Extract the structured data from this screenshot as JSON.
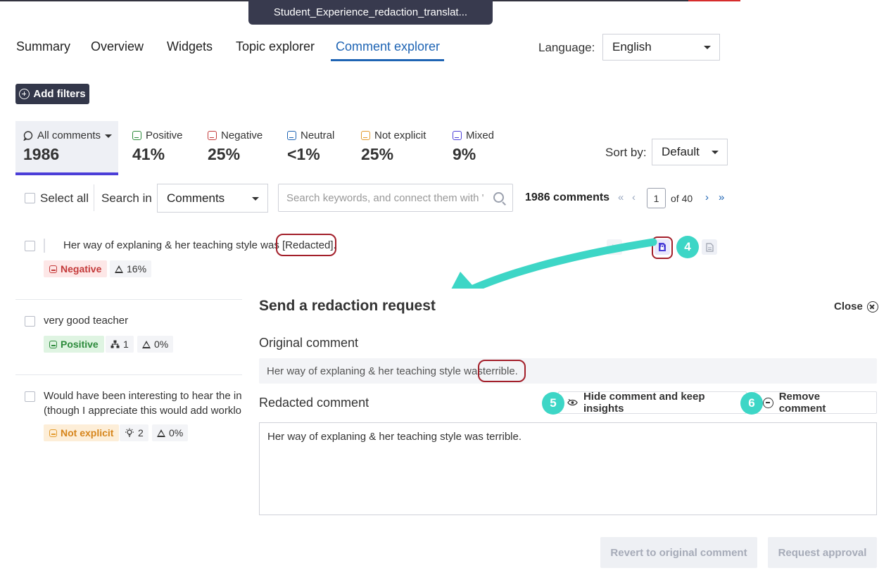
{
  "window": {
    "file_title": "Student_Experience_redaction_translat..."
  },
  "nav": {
    "tabs": [
      "Summary",
      "Overview",
      "Widgets",
      "Topic explorer",
      "Comment explorer"
    ],
    "active": "Comment explorer"
  },
  "language": {
    "label": "Language:",
    "value": "English"
  },
  "filters": {
    "add_label": "Add filters"
  },
  "sentiments": [
    {
      "label": "All comments",
      "value": "1986"
    },
    {
      "label": "Positive",
      "value": "41%",
      "color": "#2c8a3b"
    },
    {
      "label": "Negative",
      "value": "25%",
      "color": "#c43a3a"
    },
    {
      "label": "Neutral",
      "value": "<1%",
      "color": "#1e64b4"
    },
    {
      "label": "Not explicit",
      "value": "25%",
      "color": "#e39a2c"
    },
    {
      "label": "Mixed",
      "value": "9%",
      "color": "#4b3ed8"
    }
  ],
  "sort": {
    "label": "Sort by:",
    "value": "Default"
  },
  "toolbar": {
    "select_all": "Select all",
    "search_in_label": "Search in",
    "search_in_value": "Comments",
    "search_placeholder": "Search keywords, and connect them with '",
    "count": "1986 comments",
    "page_current": "1",
    "page_of": "of 40"
  },
  "comments": [
    {
      "prefix": "Her way of explaning & her teaching style was ",
      "highlight": "[Redacted]",
      "suffix": ".",
      "sentiment": "Negative",
      "warn": "16%"
    },
    {
      "text": "very good teacher",
      "sentiment": "Positive",
      "topics": "1",
      "warn": "0%"
    },
    {
      "line1": "Would have been interesting to hear the in",
      "line2": "(though I appreciate this would add worklo",
      "sentiment": "Not explicit",
      "ideas": "2",
      "warn": "0%"
    }
  ],
  "badges": {
    "b4": "4",
    "b5": "5",
    "b6": "6"
  },
  "panel": {
    "title": "Send a redaction request",
    "close": "Close",
    "original_heading": "Original comment",
    "original_prefix": "Her way of explaning & her teaching style was ",
    "original_highlight": "terrible.",
    "redacted_heading": "Redacted comment",
    "hide_label": "Hide comment and keep insights",
    "remove_label": "Remove comment",
    "redacted_text": "Her way of explaning & her teaching style was terrible.",
    "revert_label": "Revert to original comment",
    "approval_label": "Request approval"
  },
  "colors": {
    "accent": "#1e64b4",
    "annotation": "#3dd6c6",
    "callout": "#a31f2a",
    "dark": "#33374a"
  },
  "icons": [
    "plus-circle-icon",
    "comment-bubble-icon",
    "caret-down-icon",
    "search-icon",
    "first-page-icon",
    "prev-page-icon",
    "next-page-icon",
    "last-page-icon",
    "warning-icon",
    "topic-tree-icon",
    "lightbulb-icon",
    "redact-document-icon",
    "eye-icon",
    "minus-circle-icon",
    "close-circle-icon"
  ]
}
